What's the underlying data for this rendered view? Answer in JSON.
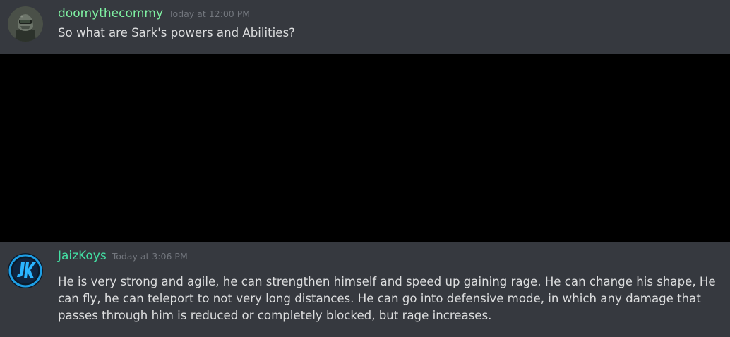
{
  "messages": [
    {
      "username": "doomythecommy",
      "username_color": "#7ff0a2",
      "timestamp": "Today at 12:00 PM",
      "text": "So what are Sark's powers and Abilities?",
      "avatar": "helmet-avatar"
    },
    {
      "username": "JaizKoys",
      "username_color": "#43e0a4",
      "timestamp": "Today at 3:06 PM",
      "text": "He is very strong and agile, he can strengthen himself and speed up gaining rage. He can change his shape, He can fly, he can teleport to not very long distances. He can go into defensive mode, in which any damage that passes through him is reduced or completely blocked, but rage increases.",
      "avatar": "jk-logo-avatar"
    }
  ],
  "colors": {
    "background": "#36393f",
    "hidden_area": "#000000",
    "text": "#dcddde",
    "timestamp": "#72767d"
  }
}
